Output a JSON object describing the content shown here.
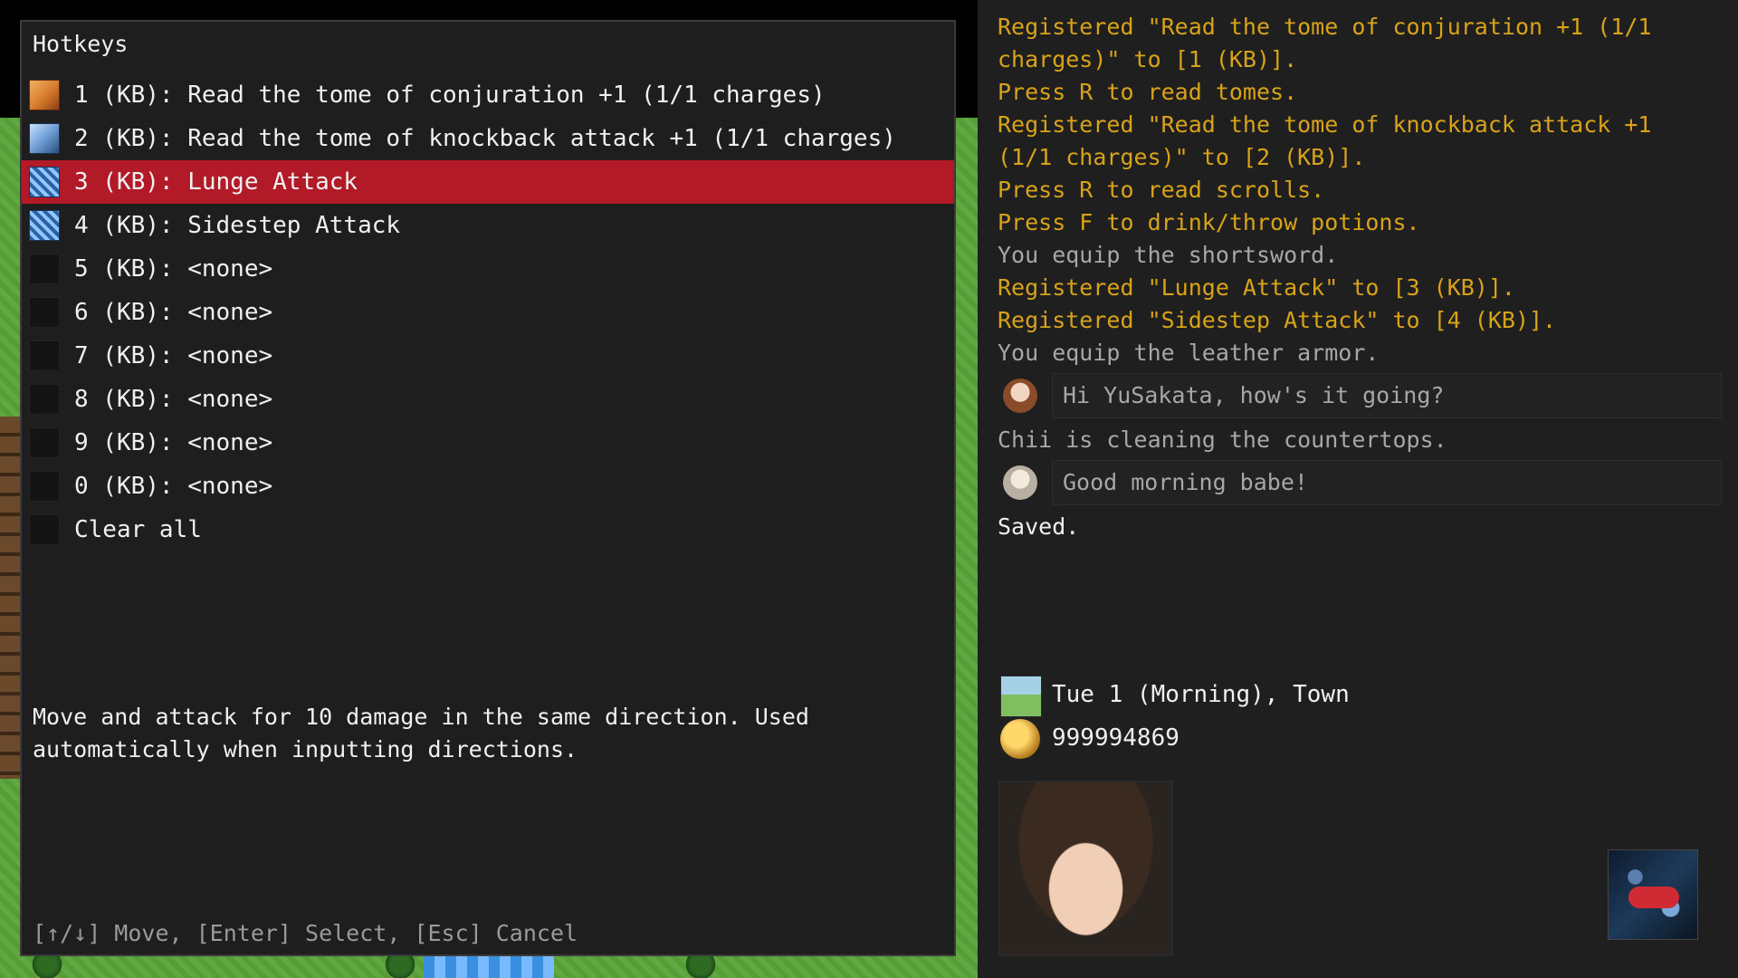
{
  "hotkeys": {
    "title": "Hotkeys",
    "items": [
      {
        "label": "1 (KB): Read the tome of conjuration +1 (1/1 charges)",
        "icon": "tome-of-conjuration-icon",
        "selected": false
      },
      {
        "label": "2 (KB): Read the tome of knockback attack +1 (1/1 charges)",
        "icon": "tome-of-knockback-icon",
        "selected": false
      },
      {
        "label": "3 (KB): Lunge Attack",
        "icon": "lunge-attack-icon",
        "selected": true
      },
      {
        "label": "4 (KB): Sidestep Attack",
        "icon": "sidestep-attack-icon",
        "selected": false
      },
      {
        "label": "5 (KB): <none>",
        "icon": "empty-slot-icon",
        "selected": false
      },
      {
        "label": "6 (KB): <none>",
        "icon": "empty-slot-icon",
        "selected": false
      },
      {
        "label": "7 (KB): <none>",
        "icon": "empty-slot-icon",
        "selected": false
      },
      {
        "label": "8 (KB): <none>",
        "icon": "empty-slot-icon",
        "selected": false
      },
      {
        "label": "9 (KB): <none>",
        "icon": "empty-slot-icon",
        "selected": false
      },
      {
        "label": "0 (KB): <none>",
        "icon": "empty-slot-icon",
        "selected": false
      },
      {
        "label": "Clear all",
        "icon": "empty-slot-icon",
        "selected": false
      }
    ],
    "description_line1": "Move and attack for 10 damage in the same direction. Used",
    "description_line2": "automatically when inputting directions.",
    "help": "[↑/↓] Move, [Enter] Select, [Esc] Cancel"
  },
  "log": {
    "lines": [
      {
        "text": "Registered \"Read the tome of conjuration +1 (1/1",
        "color": "yellow"
      },
      {
        "text": "charges)\" to [1 (KB)].",
        "color": "yellow"
      },
      {
        "text": "Press R to read tomes.",
        "color": "yellow"
      },
      {
        "text": "Registered \"Read the tome of knockback attack +1",
        "color": "yellow"
      },
      {
        "text": "(1/1 charges)\" to [2 (KB)].",
        "color": "yellow"
      },
      {
        "text": "Press R to read scrolls.",
        "color": "yellow"
      },
      {
        "text": "Press F to drink/throw potions.",
        "color": "yellow"
      },
      {
        "text": "You equip the shortsword.",
        "color": "gray"
      },
      {
        "text": "Registered \"Lunge Attack\" to [3 (KB)].",
        "color": "yellow"
      },
      {
        "text": "Registered \"Sidestep Attack\" to [4 (KB)].",
        "color": "yellow"
      },
      {
        "text": "You equip the leather armor.",
        "color": "gray"
      }
    ],
    "chat1": "Hi YuSakata, how's it going?",
    "event": "Chii is cleaning the countertops.",
    "chat2": "Good morning babe!",
    "saved": "Saved."
  },
  "status": {
    "date": "Tue 1 (Morning), Town",
    "gold": "999994869"
  },
  "colors": {
    "selected_row": "#b11a26",
    "log_yellow": "#d8a318",
    "log_gray": "#a7a7a7"
  }
}
